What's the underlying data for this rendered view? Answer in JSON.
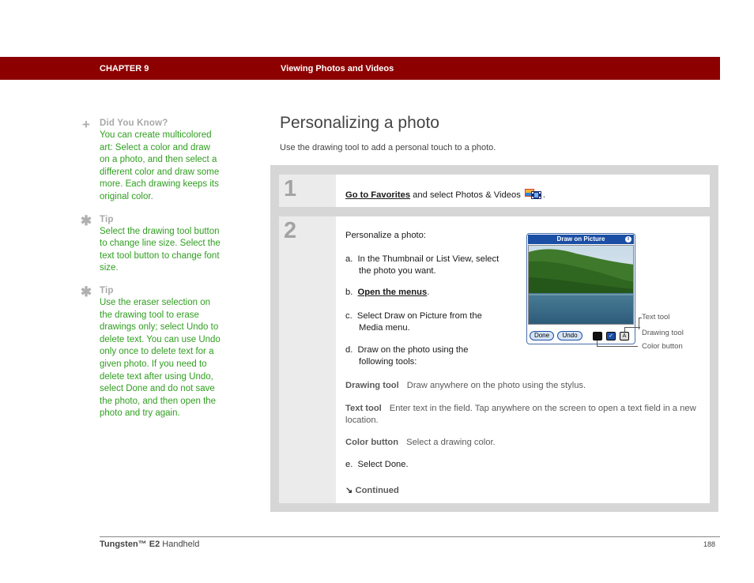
{
  "header": {
    "chapter": "CHAPTER 9",
    "title": "Viewing Photos and Videos"
  },
  "sidebar": {
    "did_you_know": {
      "heading": "Did You Know?",
      "text": "You can create multicolored art: Select a color and draw on a photo, and then select a different color and draw some more. Each drawing keeps its original color.",
      "icon": "plus-icon"
    },
    "tip1": {
      "heading": "Tip",
      "text": "Select the drawing tool button to change line size. Select the text tool button to change font size.",
      "icon": "asterisk-icon"
    },
    "tip2": {
      "heading": "Tip",
      "text": "Use the eraser selection on the drawing tool to erase drawings only; select Undo to delete text. You can use Undo only once to delete text for a given photo. If you need to delete text after using Undo, select Done and do not save the photo, and then open the photo and try again.",
      "icon": "asterisk-icon"
    }
  },
  "main": {
    "title": "Personalizing a photo",
    "intro": "Use the drawing tool to add a personal touch to a photo."
  },
  "step1": {
    "number": "1",
    "link": "Go to Favorites",
    "text_after_link": " and select Photos & Videos ",
    "end": "."
  },
  "step2": {
    "number": "2",
    "intro": "Personalize a photo:",
    "a": "a.  In the Thumbnail or List View, select the photo you want.",
    "b_prefix": "b.  ",
    "b_link": "Open the menus",
    "b_end": ".",
    "c": "c.  Select Draw on Picture from the Media menu.",
    "d": "d.  Draw on the photo using the following tools:",
    "tools": [
      {
        "term": "Drawing tool",
        "desc": "Draw anywhere on the photo using the stylus."
      },
      {
        "term": "Text tool",
        "desc": "Enter text in the field. Tap anywhere on the screen to open a text field in a new location."
      },
      {
        "term": "Color button",
        "desc": "Select a drawing color."
      }
    ],
    "e": "e.  Select Done.",
    "continued": "Continued"
  },
  "device": {
    "title": "Draw on Picture",
    "buttons": {
      "done": "Done",
      "undo": "Undo"
    },
    "text_tool_glyph": "A",
    "callouts": {
      "text_tool": "Text tool",
      "drawing_tool": "Drawing tool",
      "color_button": "Color button"
    },
    "colors": {
      "title_bar": "#1b4fa5",
      "button_fill": "#d6e4f6"
    }
  },
  "footer": {
    "product_bold": "Tungsten™ E2",
    "product_rest": " Handheld",
    "page": "188"
  },
  "colors": {
    "header_bar": "#8c0000",
    "sidebar_text": "#2f9e1f",
    "step_panel": "#d6d6d6"
  }
}
